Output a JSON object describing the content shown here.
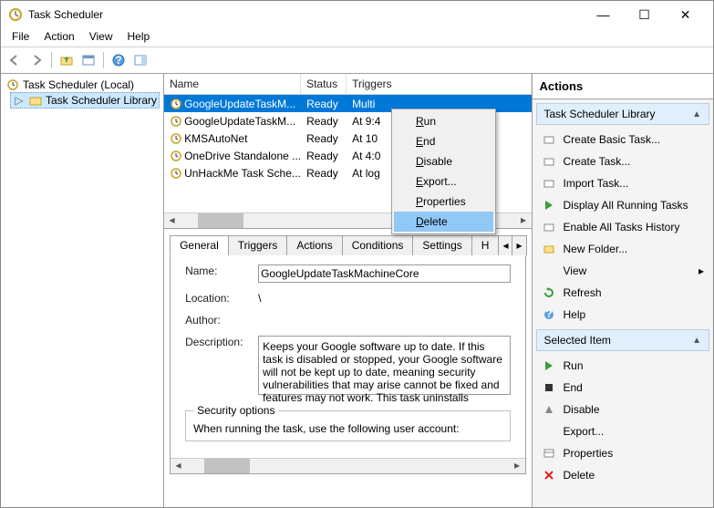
{
  "window": {
    "title": "Task Scheduler",
    "minimize": "—",
    "maximize": "☐",
    "close": "✕"
  },
  "menubar": [
    "File",
    "Action",
    "View",
    "Help"
  ],
  "tree": {
    "root": "Task Scheduler (Local)",
    "child": "Task Scheduler Library"
  },
  "columns": {
    "name": "Name",
    "status": "Status",
    "triggers": "Triggers"
  },
  "tasks": [
    {
      "name": "GoogleUpdateTaskM...",
      "status": "Ready",
      "triggers": "Multi",
      "selected": true
    },
    {
      "name": "GoogleUpdateTaskM...",
      "status": "Ready",
      "triggers": "At 9:4"
    },
    {
      "name": "KMSAutoNet",
      "status": "Ready",
      "triggers": "At 10"
    },
    {
      "name": "OneDrive Standalone ...",
      "status": "Ready",
      "triggers": "At 4:0"
    },
    {
      "name": "UnHackMe Task Sche...",
      "status": "Ready",
      "triggers": "At log"
    }
  ],
  "context_menu": {
    "items": [
      "Run",
      "End",
      "Disable",
      "Export...",
      "Properties",
      "Delete"
    ],
    "selected": "Delete"
  },
  "tabs": {
    "items": [
      "General",
      "Triggers",
      "Actions",
      "Conditions",
      "Settings",
      "H"
    ],
    "active": "General"
  },
  "general": {
    "name_label": "Name:",
    "name_value": "GoogleUpdateTaskMachineCore",
    "location_label": "Location:",
    "location_value": "\\",
    "author_label": "Author:",
    "author_value": "",
    "description_label": "Description:",
    "description_value": "Keeps your Google software up to date. If this task is disabled or stopped, your Google software will not be kept up to date, meaning security vulnerabilities that may arise cannot be fixed and features may not work. This task uninstalls",
    "security_legend": "Security options",
    "security_text": "When running the task, use the following user account:"
  },
  "actions": {
    "title": "Actions",
    "section1": {
      "header": "Task Scheduler Library",
      "items": [
        "Create Basic Task...",
        "Create Task...",
        "Import Task...",
        "Display All Running Tasks",
        "Enable All Tasks History",
        "New Folder...",
        "View",
        "Refresh",
        "Help"
      ]
    },
    "section2": {
      "header": "Selected Item",
      "items": [
        "Run",
        "End",
        "Disable",
        "Export...",
        "Properties",
        "Delete"
      ]
    }
  }
}
